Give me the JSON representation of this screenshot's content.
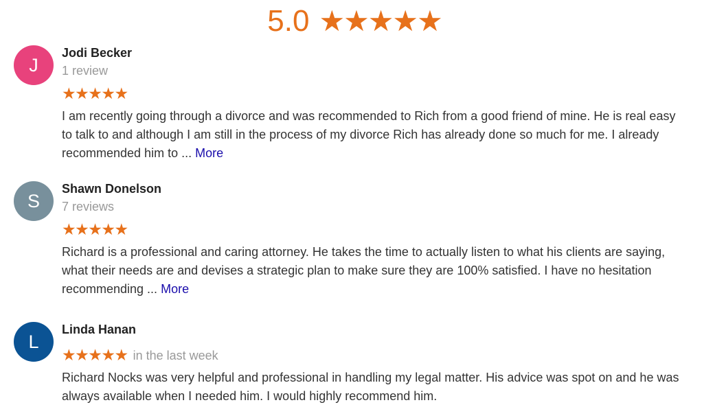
{
  "header": {
    "score": "5.0",
    "stars": "★★★★★"
  },
  "colors": {
    "accent_orange": "#e7711b",
    "link_blue": "#1a0dab",
    "muted_gray": "#999999"
  },
  "reviews": [
    {
      "initial": "J",
      "avatar_color": "#e8427c",
      "name": "Jodi Becker",
      "review_count": "1 review",
      "stars": "★★★★★",
      "time": "",
      "text": "I am recently going through a divorce and was recommended to Rich from a good friend of mine. He is real easy to talk to and although I am still in the process of my divorce Rich has already done so much for me. I already recommended him to ...",
      "more_label": "More"
    },
    {
      "initial": "S",
      "avatar_color": "#78909c",
      "name": "Shawn Donelson",
      "review_count": "7 reviews",
      "stars": "★★★★★",
      "time": "",
      "text": "Richard is a professional and caring attorney. He takes the time to actually listen to what his clients are saying, what their needs are and devises a strategic plan to make sure they are 100% satisfied. I have no hesitation recommending ...",
      "more_label": "More"
    },
    {
      "initial": "L",
      "avatar_color": "#0b5394",
      "name": "Linda Hanan",
      "review_count": "",
      "stars": "★★★★★",
      "time": "in the last week",
      "text": "Richard Nocks was very helpful and professional in handling my legal matter.  His advice was spot on and he was always available when I needed him.  I would highly recommend him.",
      "more_label": ""
    }
  ]
}
